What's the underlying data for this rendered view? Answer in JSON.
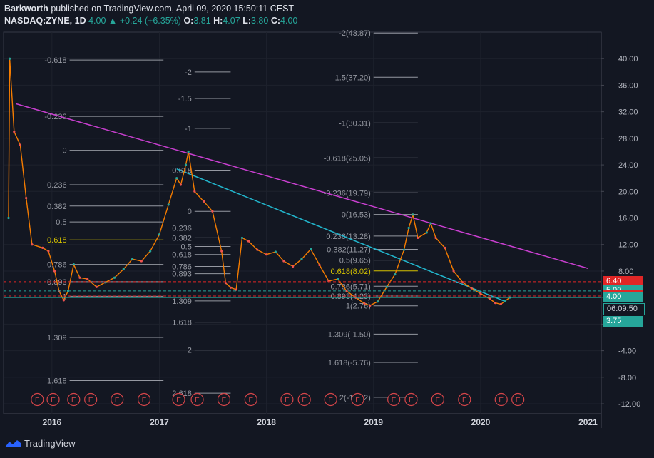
{
  "header": {
    "publisher": "Barkworth",
    "published_text": "published on TradingView.com, April 09, 2020 15:50:11 CEST",
    "symbol": "NASDAQ:ZYNE",
    "interval": "1D",
    "last": "4.00",
    "change": "+0.24 (+6.35%)",
    "o_label": "O:",
    "o_value": "3.81",
    "h_label": "H:",
    "h_value": "4.07",
    "l_label": "L:",
    "l_value": "3.80",
    "c_label": "C:",
    "c_value": "4.00"
  },
  "footer": {
    "brand": "TradingView"
  },
  "colors": {
    "background": "#131722",
    "up": "#26a69a",
    "down": "#ef5350",
    "trendline_magenta": "#c93fd0",
    "trendline_cyan": "#22b8cf",
    "fib_gold": "#d4c100",
    "earnings": "#d64549"
  },
  "chart_data": {
    "type": "line",
    "x_ticks": [
      "2016",
      "2017",
      "2018",
      "2019",
      "2020",
      "2021"
    ],
    "y_ticks": [
      "40.00",
      "36.00",
      "32.00",
      "28.00",
      "24.00",
      "20.00",
      "16.00",
      "12.00",
      "8.00",
      "4.00",
      "0.00",
      "-4.00",
      "-8.00",
      "-12.00"
    ],
    "ylim": [
      -13.5,
      44
    ],
    "series": [
      {
        "values": [
          [
            "2015-08-06",
            16
          ],
          [
            "2015-08-10",
            40
          ],
          [
            "2015-08-25",
            29
          ],
          [
            "2015-09-15",
            27
          ],
          [
            "2015-10-05",
            19
          ],
          [
            "2015-10-25",
            12
          ],
          [
            "2015-11-30",
            11.5
          ],
          [
            "2015-12-20",
            11
          ],
          [
            "2016-01-10",
            8
          ],
          [
            "2016-01-25",
            5
          ],
          [
            "2016-02-10",
            3.6
          ],
          [
            "2016-02-25",
            5
          ],
          [
            "2016-03-15",
            9
          ],
          [
            "2016-04-05",
            7
          ],
          [
            "2016-05-01",
            6.8
          ],
          [
            "2016-06-01",
            5.6
          ],
          [
            "2016-07-01",
            6.3
          ],
          [
            "2016-08-01",
            7
          ],
          [
            "2016-09-01",
            8.3
          ],
          [
            "2016-10-01",
            9.8
          ],
          [
            "2016-11-01",
            9.5
          ],
          [
            "2016-12-01",
            11
          ],
          [
            "2017-01-01",
            13.5
          ],
          [
            "2017-02-01",
            18
          ],
          [
            "2017-03-01",
            22
          ],
          [
            "2017-03-15",
            21
          ],
          [
            "2017-04-01",
            24
          ],
          [
            "2017-04-10",
            26
          ],
          [
            "2017-05-01",
            20
          ],
          [
            "2017-06-01",
            18.5
          ],
          [
            "2017-07-01",
            17
          ],
          [
            "2017-08-01",
            11
          ],
          [
            "2017-08-15",
            6.2
          ],
          [
            "2017-09-01",
            5.5
          ],
          [
            "2017-09-20",
            5.2
          ],
          [
            "2017-10-10",
            13
          ],
          [
            "2017-11-01",
            12.5
          ],
          [
            "2017-12-01",
            11.2
          ],
          [
            "2018-01-01",
            10.5
          ],
          [
            "2018-02-01",
            10.9
          ],
          [
            "2018-03-01",
            9.5
          ],
          [
            "2018-04-01",
            8.7
          ],
          [
            "2018-05-01",
            9.8
          ],
          [
            "2018-06-01",
            11.3
          ],
          [
            "2018-07-01",
            8.9
          ],
          [
            "2018-08-01",
            6.5
          ],
          [
            "2018-09-01",
            6.8
          ],
          [
            "2018-10-01",
            5
          ],
          [
            "2018-11-01",
            4
          ],
          [
            "2018-12-01",
            3.1
          ],
          [
            "2018-12-20",
            2.8
          ],
          [
            "2019-01-15",
            3.4
          ],
          [
            "2019-02-15",
            5.6
          ],
          [
            "2019-03-15",
            7.5
          ],
          [
            "2019-04-15",
            11.2
          ],
          [
            "2019-05-01",
            14.5
          ],
          [
            "2019-05-15",
            16.5
          ],
          [
            "2019-06-01",
            13
          ],
          [
            "2019-07-01",
            13.8
          ],
          [
            "2019-07-15",
            15.2
          ],
          [
            "2019-08-01",
            13
          ],
          [
            "2019-09-01",
            11.5
          ],
          [
            "2019-10-01",
            8
          ],
          [
            "2019-11-01",
            6.3
          ],
          [
            "2019-12-01",
            5.4
          ],
          [
            "2020-01-01",
            4.6
          ],
          [
            "2020-02-01",
            3.8
          ],
          [
            "2020-02-20",
            3.2
          ],
          [
            "2020-03-10",
            3.0
          ],
          [
            "2020-03-25",
            3.5
          ],
          [
            "2020-04-09",
            4.0
          ]
        ]
      }
    ],
    "trendlines": [
      {
        "from": [
          "2015-09-01",
          33.2
        ],
        "to": [
          "2021-01-01",
          8.4
        ]
      },
      {
        "from": [
          "2017-03-01",
          23.4
        ],
        "to": [
          "2020-03-20",
          3.5
        ]
      }
    ],
    "fib_sets": [
      {
        "x_range": [
          "2016-03-01",
          "2017-01-15"
        ],
        "levels": [
          {
            "label": "-0.618",
            "value": 39.8
          },
          {
            "label": "-0.236",
            "value": 31.3
          },
          {
            "label": "0",
            "value": 26.2
          },
          {
            "label": "0.236",
            "value": 21.0
          },
          {
            "label": "0.382",
            "value": 17.8
          },
          {
            "label": "0.5",
            "value": 15.4
          },
          {
            "label": "0.618",
            "value": 12.7
          },
          {
            "label": "0.786",
            "value": 9.0
          },
          {
            "label": "0.893",
            "value": 6.4
          },
          {
            "label": "1",
            "value": 4.2
          },
          {
            "label": "1.309",
            "value": -2.0
          },
          {
            "label": "1.618",
            "value": -8.5
          }
        ]
      },
      {
        "x_range": [
          "2017-05-01",
          "2017-09-01"
        ],
        "levels": [
          {
            "label": "-2",
            "value": 38.0
          },
          {
            "label": "-1.5",
            "value": 34.0
          },
          {
            "label": "-1",
            "value": 29.5
          },
          {
            "label": "0.618",
            "value": 23.2
          },
          {
            "label": "0",
            "value": 17.0
          },
          {
            "label": "0.236",
            "value": 14.5
          },
          {
            "label": "0.382",
            "value": 13.0
          },
          {
            "label": "0.5",
            "value": 11.7
          },
          {
            "label": "0.618",
            "value": 10.5
          },
          {
            "label": "0.786",
            "value": 8.7
          },
          {
            "label": "0.893",
            "value": 7.6
          },
          {
            "label": "1.309",
            "value": 3.5
          },
          {
            "label": "1.618",
            "value": 0.3
          },
          {
            "label": "2",
            "value": -3.9
          },
          {
            "label": "2.618",
            "value": -10.4
          }
        ]
      },
      {
        "x_range": [
          "2019-01-01",
          "2019-06-01"
        ],
        "levels": [
          {
            "label": "-2(43.87)",
            "value": 43.87
          },
          {
            "label": "-1.5(37.20)",
            "value": 37.2
          },
          {
            "label": "-1(30.31)",
            "value": 30.31
          },
          {
            "label": "-0.618(25.05)",
            "value": 25.05
          },
          {
            "label": "-0.236(19.79)",
            "value": 19.79
          },
          {
            "label": "0(16.53)",
            "value": 16.53
          },
          {
            "label": "0.236(13.28)",
            "value": 13.28
          },
          {
            "label": "0.382(11.27)",
            "value": 11.27
          },
          {
            "label": "0.5(9.65)",
            "value": 9.65
          },
          {
            "label": "0.618(8.02)",
            "value": 8.02
          },
          {
            "label": "0.786(5.71)",
            "value": 5.71
          },
          {
            "label": "0.893(4.23)",
            "value": 4.23
          },
          {
            "label": "1(2.76)",
            "value": 2.76
          },
          {
            "label": "1.309(-1.50)",
            "value": -1.5
          },
          {
            "label": "1.618(-5.76)",
            "value": -5.76
          },
          {
            "label": "2(-11.02)",
            "value": -11.02
          }
        ]
      }
    ],
    "price_lines": [
      {
        "label": "6.40",
        "value": 6.4,
        "color": "#e02626",
        "dash": true
      },
      {
        "label": "5.00",
        "value": 5.0,
        "color": "#26a69a",
        "dash": true
      },
      {
        "label": "4.23",
        "value": 4.23,
        "color": "#e02626",
        "dash": true
      },
      {
        "label": "4.00",
        "value": 4.0,
        "color": "#26a69a",
        "dash": false
      }
    ],
    "countdown": "06:09:50",
    "extra_tag": {
      "label": "3.75",
      "value": 3.75
    },
    "earnings_dates": [
      "2015-11-12",
      "2016-01-05",
      "2016-03-15",
      "2016-05-12",
      "2016-08-10",
      "2016-11-10",
      "2017-03-08",
      "2017-05-10",
      "2017-08-09",
      "2017-11-09",
      "2018-03-12",
      "2018-05-10",
      "2018-08-08",
      "2018-11-08",
      "2019-03-11",
      "2019-05-09",
      "2019-08-08",
      "2019-11-07",
      "2020-03-11",
      "2020-05-07"
    ],
    "earnings_label": "E"
  }
}
